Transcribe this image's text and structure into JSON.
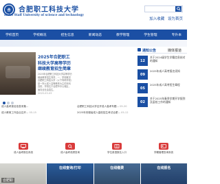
{
  "header": {
    "logo_cn": "合肥职工科技大学",
    "logo_en": "Hefei Staff University of science and technology",
    "emblem_text": "合",
    "search": {
      "placeholder": ""
    },
    "top_links": [
      "加入收藏",
      "设为首页"
    ]
  },
  "nav": {
    "items": [
      "学校首页",
      "学校概况",
      "招生信息",
      "新闻动态",
      "教学管理",
      "学生管理",
      "专升本"
    ]
  },
  "feature": {
    "title": "2025年合肥职工科技大学高等学历 继续教育招生简章",
    "summary": "2025年合肥职工科技大学高等学历继续教育招生简章，一、学校概况合肥职工科技大学（以下简称学校）是一所以成人高等教育为主的本科高校，学校位于合肥市中心城区，面向全社会招生。",
    "date": "2025-03-03",
    "dots": 3,
    "active_dot": 0
  },
  "news_list": [
    {
      "title": "成人高考报名信息采集...",
      "date": ""
    },
    {
      "title": "合肥职工科技大学召开成人高考专题...",
      "date": "05-20"
    },
    {
      "title": "成人教育工作会议召开...",
      "date": "05-15"
    },
    {
      "title": "2025年安徽省成人高校招生考试合肥...",
      "date": "05-12"
    }
  ],
  "notice": {
    "tabs": [
      "通知公告",
      "媒体报道"
    ],
    "active_tab": 0,
    "items": [
      {
        "day": "12",
        "text": "关于2024级学生学籍信息核对的通知"
      },
      {
        "day": "09",
        "text": "2025年成人高考报名须知"
      },
      {
        "day": "05",
        "text": "2025年成人高考招生章程"
      },
      {
        "day": "02",
        "text": "关于2025年春季学期开学报到及返校工作的通知"
      }
    ]
  },
  "quick_links": [
    {
      "label": "成人高考报名系统",
      "icon": "computer-icon"
    },
    {
      "label": "成人高考成绩查询",
      "icon": "search-doc-icon"
    },
    {
      "label": "学位英语报名入口",
      "icon": "book-icon"
    },
    {
      "label": "学籍管理查询系统",
      "icon": "id-card-icon"
    }
  ],
  "tiles": [
    {
      "label": "",
      "sub": "",
      "caption": "合肥职"
    },
    {
      "label": "在线查询/打印",
      "sub": ""
    },
    {
      "label": "在线缴费",
      "sub": ""
    },
    {
      "label": "在线报名",
      "sub": ""
    }
  ],
  "colors": {
    "brand": "#1a4fa3",
    "nav": "#1b4fa4",
    "accent_red": "#d93b3b"
  }
}
